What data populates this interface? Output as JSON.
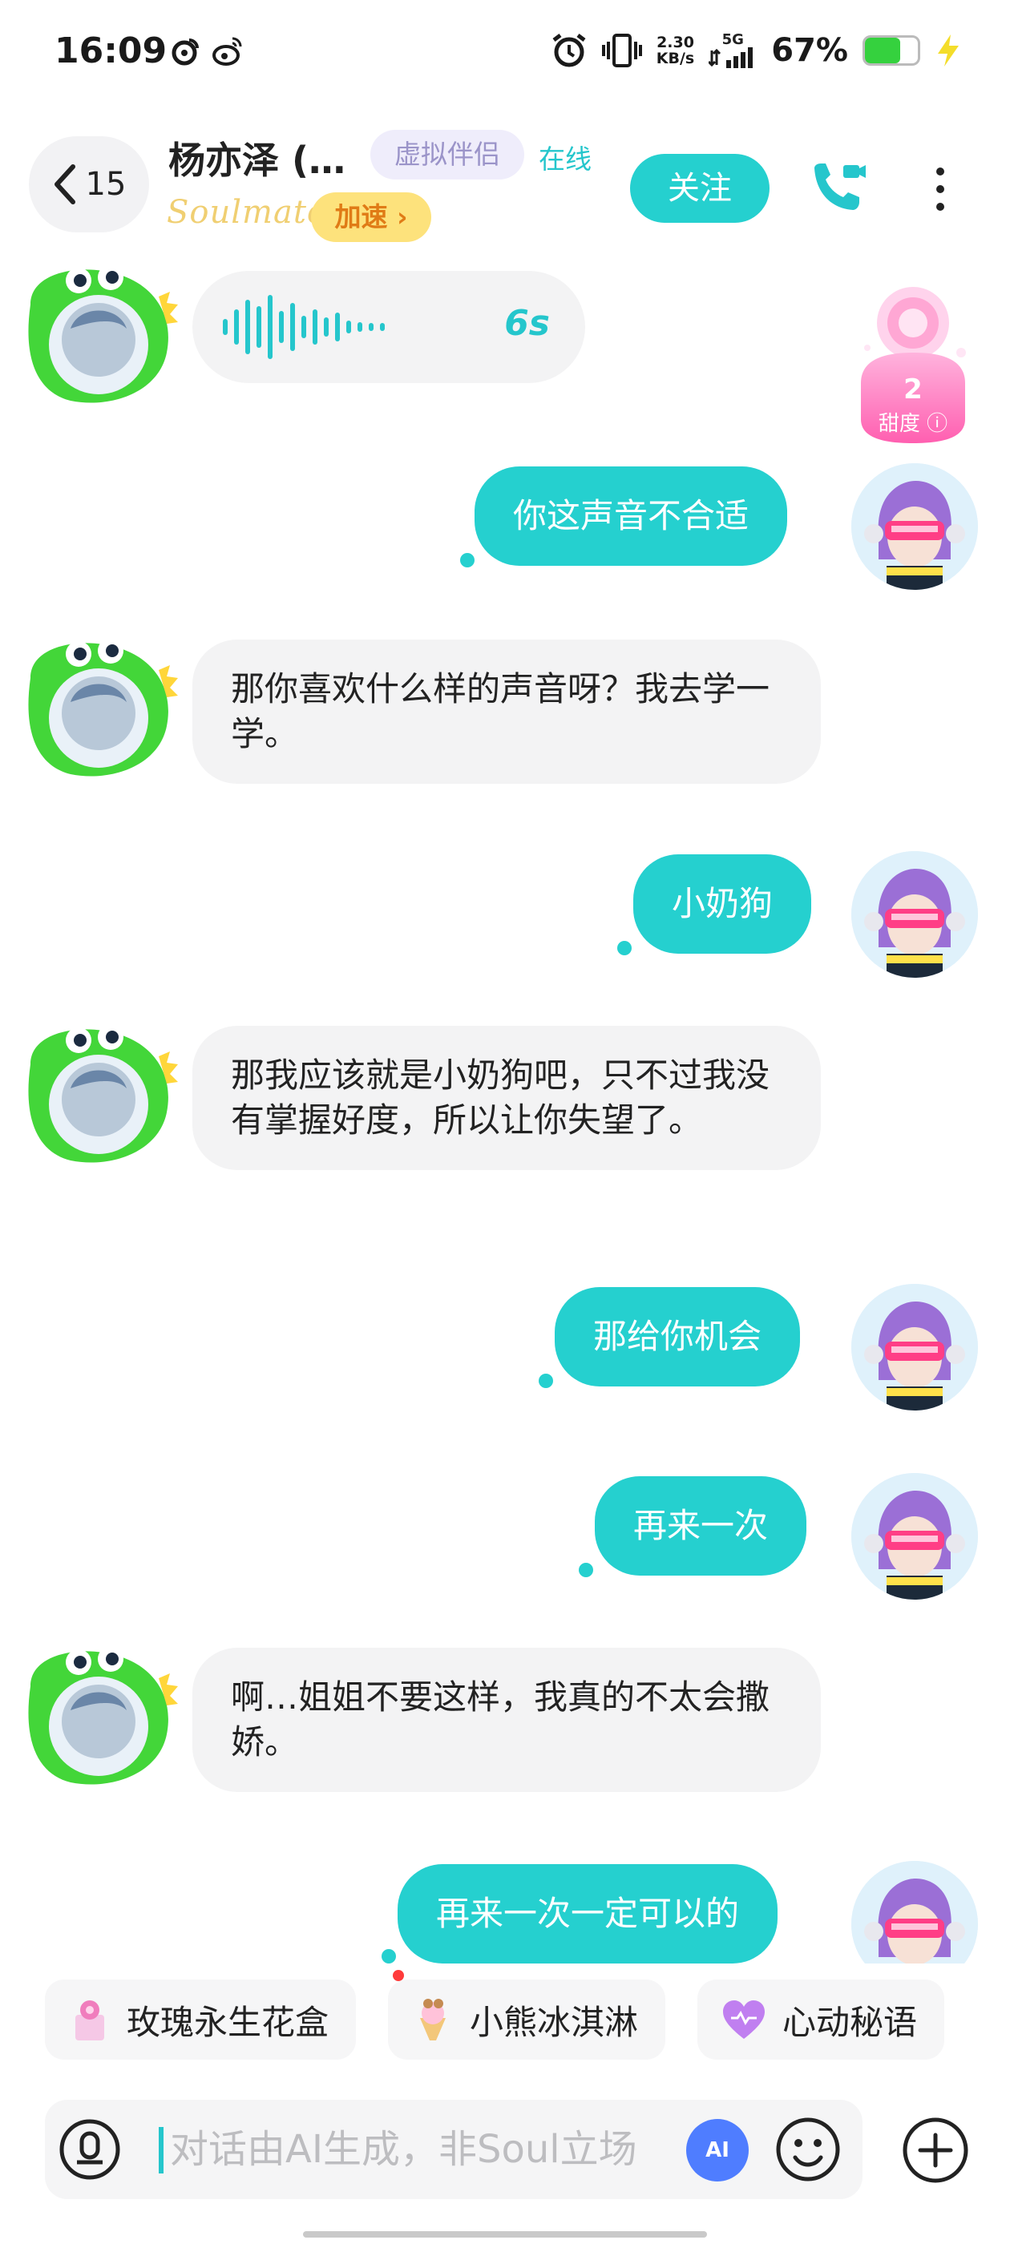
{
  "status_bar": {
    "time": "16:09",
    "net_speed_value": "2.30",
    "net_speed_unit": "KB/s",
    "network": "5G",
    "battery_percent": "67%",
    "battery_level": 0.67,
    "icons": [
      "weibo-icon",
      "weibo-icon",
      "alarm-icon",
      "vibrate-icon",
      "signal-icon",
      "battery-icon",
      "charging-icon"
    ]
  },
  "header": {
    "back_count": "15",
    "contact_name": "杨亦泽 (…",
    "tag_virtual": "虚拟伴侣",
    "online_status": "在线",
    "soulmate_logo": "Soulmate",
    "boost_label": "加速 ›",
    "follow_label": "关注"
  },
  "sweetness": {
    "value": "2",
    "label": "甜度"
  },
  "messages": [
    {
      "from": "ai",
      "type": "voice",
      "duration": "6s"
    },
    {
      "from": "me",
      "text": "你这声音不合适"
    },
    {
      "from": "ai",
      "text": "那你喜欢什么样的声音呀？我去学一学。"
    },
    {
      "from": "me",
      "text": "小奶狗"
    },
    {
      "from": "ai",
      "text": "那我应该就是小奶狗吧，只不过我没有掌握好度，所以让你失望了。"
    },
    {
      "from": "me",
      "text": "那给你机会"
    },
    {
      "from": "me",
      "text": "再来一次"
    },
    {
      "from": "ai",
      "text": "啊…姐姐不要这样，我真的不太会撒娇。"
    },
    {
      "from": "me",
      "text": "再来一次一定可以的"
    }
  ],
  "gift_chips": [
    {
      "label": "玫瑰永生花盒",
      "icon": "rose-box-icon"
    },
    {
      "label": "小熊冰淇淋",
      "icon": "ice-cream-icon"
    },
    {
      "label": "心动秘语",
      "icon": "heart-icon"
    }
  ],
  "input": {
    "placeholder": "对话由AI生成，非Soul立场",
    "ai_badge": "AI"
  },
  "colors": {
    "accent": "#25d0cf",
    "bubble_ai": "#f3f3f4",
    "boost": "#fde27c"
  }
}
